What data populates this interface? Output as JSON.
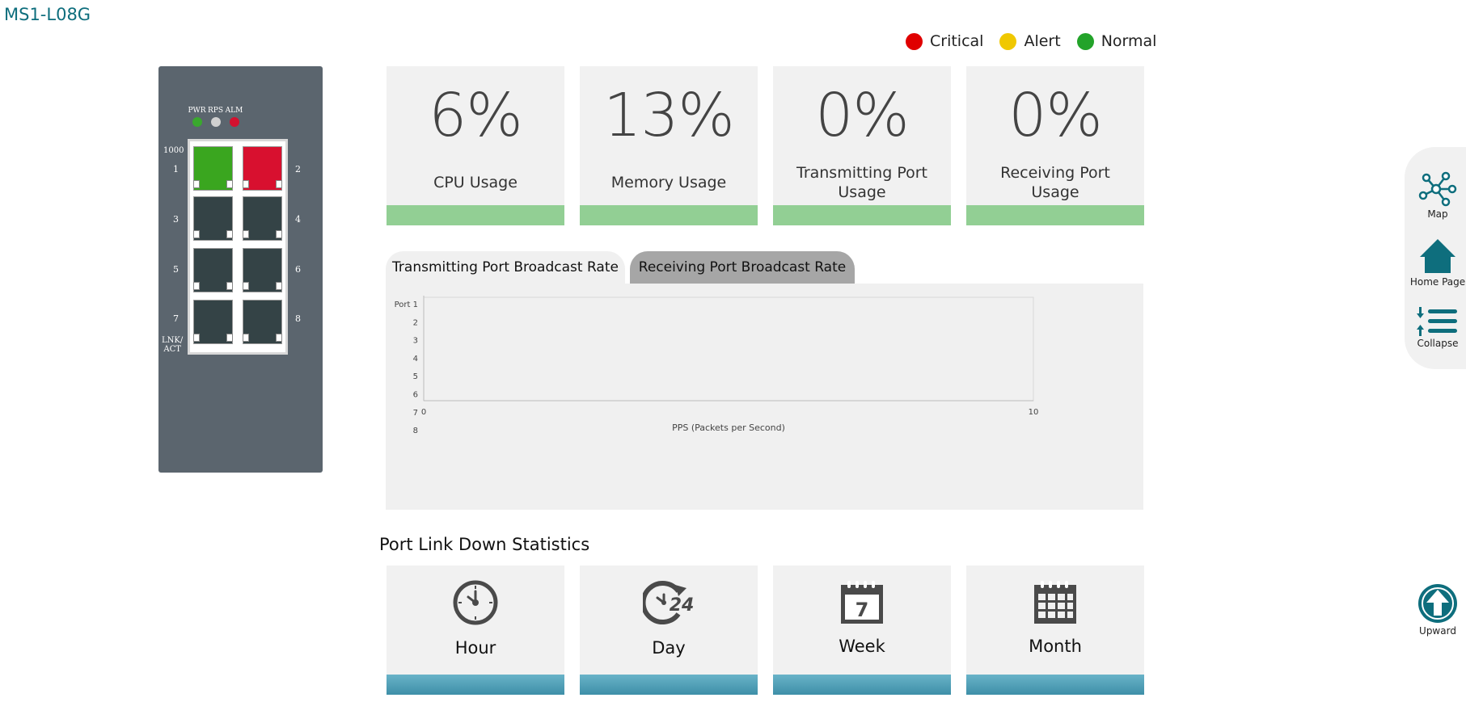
{
  "title": "MS1-L08G",
  "legend": [
    {
      "label": "Critical",
      "color": "#e00000"
    },
    {
      "label": "Alert",
      "color": "#f0c800"
    },
    {
      "label": "Normal",
      "color": "#23a32a"
    }
  ],
  "switch": {
    "leds": [
      {
        "label": "PWR",
        "color": "#3aa82e"
      },
      {
        "label": "RPS",
        "color": "#d0d0d0"
      },
      {
        "label": "ALM",
        "color": "#d4112f"
      }
    ],
    "speed_label": "1000",
    "link_label_line1": "LNK/",
    "link_label_line2": "ACT",
    "ports": [
      {
        "num": "1",
        "color": "#3aa61f"
      },
      {
        "num": "2",
        "color": "#d8102f"
      },
      {
        "num": "3",
        "color": "#344346"
      },
      {
        "num": "4",
        "color": "#344346"
      },
      {
        "num": "5",
        "color": "#344346"
      },
      {
        "num": "6",
        "color": "#344346"
      },
      {
        "num": "7",
        "color": "#344346"
      },
      {
        "num": "8",
        "color": "#344346"
      }
    ]
  },
  "stats": [
    {
      "value": "6%",
      "label": "CPU Usage"
    },
    {
      "value": "13%",
      "label": "Memory Usage"
    },
    {
      "value": "0%",
      "label": "Transmitting Port Usage"
    },
    {
      "value": "0%",
      "label": "Receiving Port Usage"
    }
  ],
  "tabs": {
    "tx": "Transmitting Port Broadcast Rate",
    "rx": "Receiving Port Broadcast Rate"
  },
  "chart_data": {
    "type": "bar",
    "orientation": "horizontal",
    "categories": [
      "Port 1",
      "2",
      "3",
      "4",
      "5",
      "6",
      "7",
      "8"
    ],
    "values": [
      0,
      0,
      0,
      0,
      0,
      0,
      0,
      0
    ],
    "xlabel": "PPS (Packets per Second)",
    "xlim": [
      0,
      10
    ],
    "x_ticks": [
      "0",
      "10"
    ],
    "grid": false
  },
  "section_title": "Port Link Down Statistics",
  "periods": [
    {
      "label": "Hour",
      "icon": "clock-icon"
    },
    {
      "label": "Day",
      "icon": "clock-24-icon"
    },
    {
      "label": "Week",
      "icon": "calendar-7-icon"
    },
    {
      "label": "Month",
      "icon": "calendar-month-icon"
    }
  ],
  "period_icon_text": {
    "day": "24",
    "week": "7"
  },
  "nav": {
    "map": "Map",
    "home": "Home Page",
    "collapse": "Collapse",
    "upward": "Upward"
  },
  "colors": {
    "teal": "#0e6e7d",
    "usage_bar": "#92cf94",
    "period_bar": "#4e9fb7"
  }
}
